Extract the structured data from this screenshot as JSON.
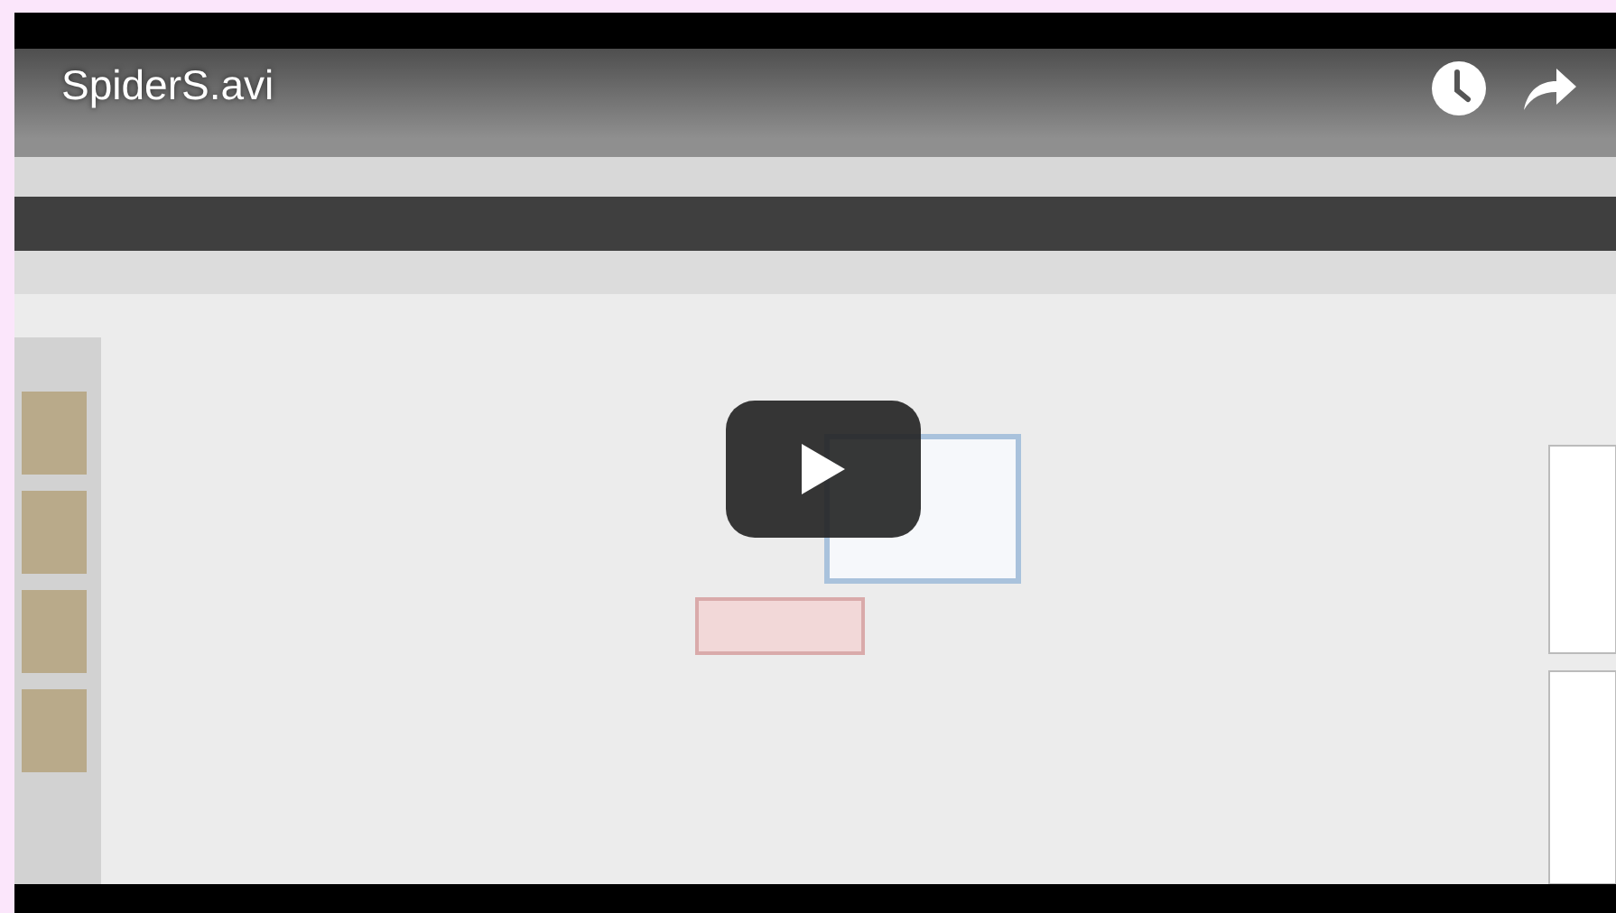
{
  "video": {
    "title": "SpiderS.avi"
  }
}
